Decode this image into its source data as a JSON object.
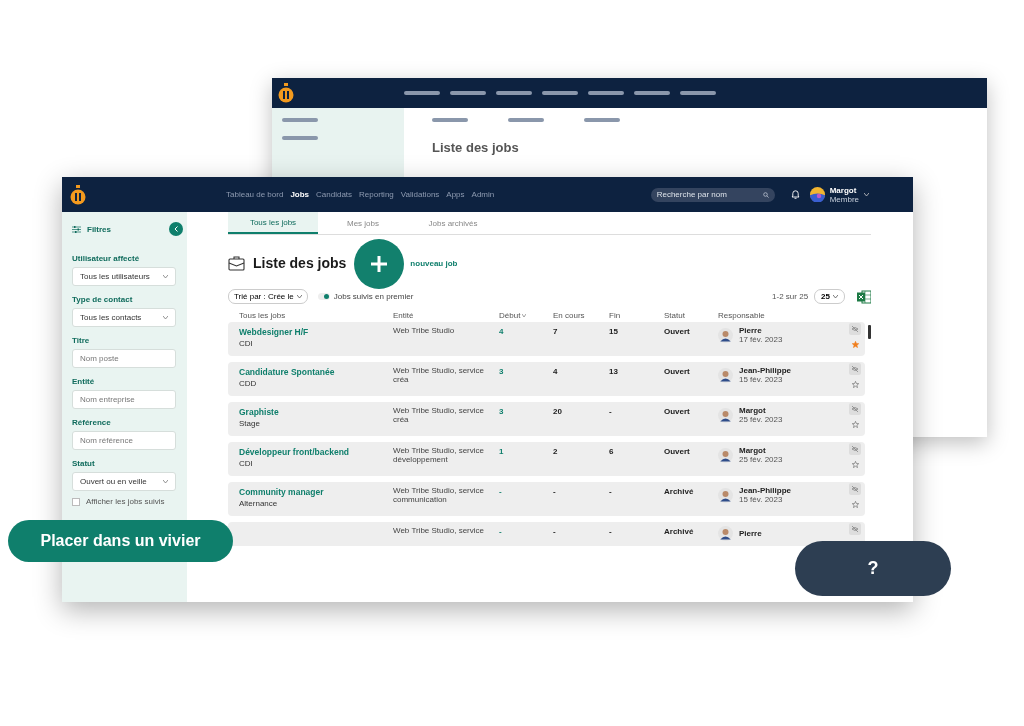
{
  "back_window": {
    "title": "Liste des jobs"
  },
  "navbar": {
    "items": [
      {
        "label": "Tableau de bord",
        "selected": false
      },
      {
        "label": "Jobs",
        "selected": true
      },
      {
        "label": "Candidats",
        "selected": false
      },
      {
        "label": "Reporting",
        "selected": false
      },
      {
        "label": "Validations",
        "selected": false
      },
      {
        "label": "Apps",
        "selected": false
      },
      {
        "label": "Admin",
        "selected": false
      }
    ],
    "search": {
      "placeholder": "Recherche par nom"
    },
    "user": {
      "name": "Margot",
      "role": "Membre"
    }
  },
  "sidebar": {
    "title": "Filtres",
    "filters": [
      {
        "kind": "select",
        "label": "Utilisateur affecté",
        "value": "Tous les utilisateurs"
      },
      {
        "kind": "select",
        "label": "Type de contact",
        "value": "Tous les contacts"
      },
      {
        "kind": "input",
        "label": "Titre",
        "placeholder": "Nom poste"
      },
      {
        "kind": "input",
        "label": "Entité",
        "placeholder": "Nom entreprise"
      },
      {
        "kind": "input",
        "label": "Référence",
        "placeholder": "Nom référence"
      },
      {
        "kind": "select",
        "label": "Statut",
        "value": "Ouvert ou en veille"
      }
    ],
    "checkbox": {
      "label": "Afficher les jobs suivis",
      "checked": false
    }
  },
  "tabs": [
    {
      "label": "Tous les jobs",
      "selected": true
    },
    {
      "label": "Mes jobs",
      "selected": false
    },
    {
      "label": "Jobs archivés",
      "selected": false
    }
  ],
  "title": "Liste des jobs",
  "create_link": "nouveau job",
  "sort": {
    "label": "Trié par : Crée le"
  },
  "toggle": {
    "label": "Jobs suivis en premier",
    "on": true
  },
  "pagination": {
    "range": "1-2 sur 25",
    "page_size": "25"
  },
  "table": {
    "columns": [
      "Tous les jobs",
      "Entité",
      "Début",
      "En cours",
      "Fin",
      "Statut",
      "Responsable"
    ],
    "rows": [
      {
        "title": "Webdesigner H/F",
        "type": "CDI",
        "entity": "Web Tribe Studio",
        "debut": "4",
        "en_cours": "7",
        "fin": "15",
        "status": "Ouvert",
        "owner": "Pierre",
        "date": "17 fév. 2023",
        "starred": true
      },
      {
        "title": "Candidature Spontanée",
        "type": "CDD",
        "entity": "Web Tribe Studio, service créa",
        "debut": "3",
        "en_cours": "4",
        "fin": "13",
        "status": "Ouvert",
        "owner": "Jean-Philippe",
        "date": "15 fév. 2023",
        "starred": false
      },
      {
        "title": "Graphiste",
        "type": "Stage",
        "entity": "Web Tribe Studio, service créa",
        "debut": "3",
        "en_cours": "20",
        "fin": "-",
        "status": "Ouvert",
        "owner": "Margot",
        "date": "25 fév. 2023",
        "starred": false
      },
      {
        "title": "Développeur front/backend",
        "type": "CDI",
        "entity": "Web Tribe Studio, service développement",
        "debut": "1",
        "en_cours": "2",
        "fin": "6",
        "status": "Ouvert",
        "owner": "Margot",
        "date": "25 fév. 2023",
        "starred": false
      },
      {
        "title": "Community manager",
        "type": "Alternance",
        "entity": "Web Tribe Studio, service communication",
        "debut": "-",
        "en_cours": "-",
        "fin": "-",
        "status": "Archivé",
        "owner": "Jean-Philippe",
        "date": "15 fév. 2023",
        "starred": false
      },
      {
        "entity": "Web Tribe Studio, service",
        "debut": "-",
        "en_cours": "-",
        "fin": "-",
        "status": "Archivé",
        "owner": "Pierre"
      }
    ]
  },
  "pool_button": "Placer dans un vivier",
  "help_button": "?"
}
